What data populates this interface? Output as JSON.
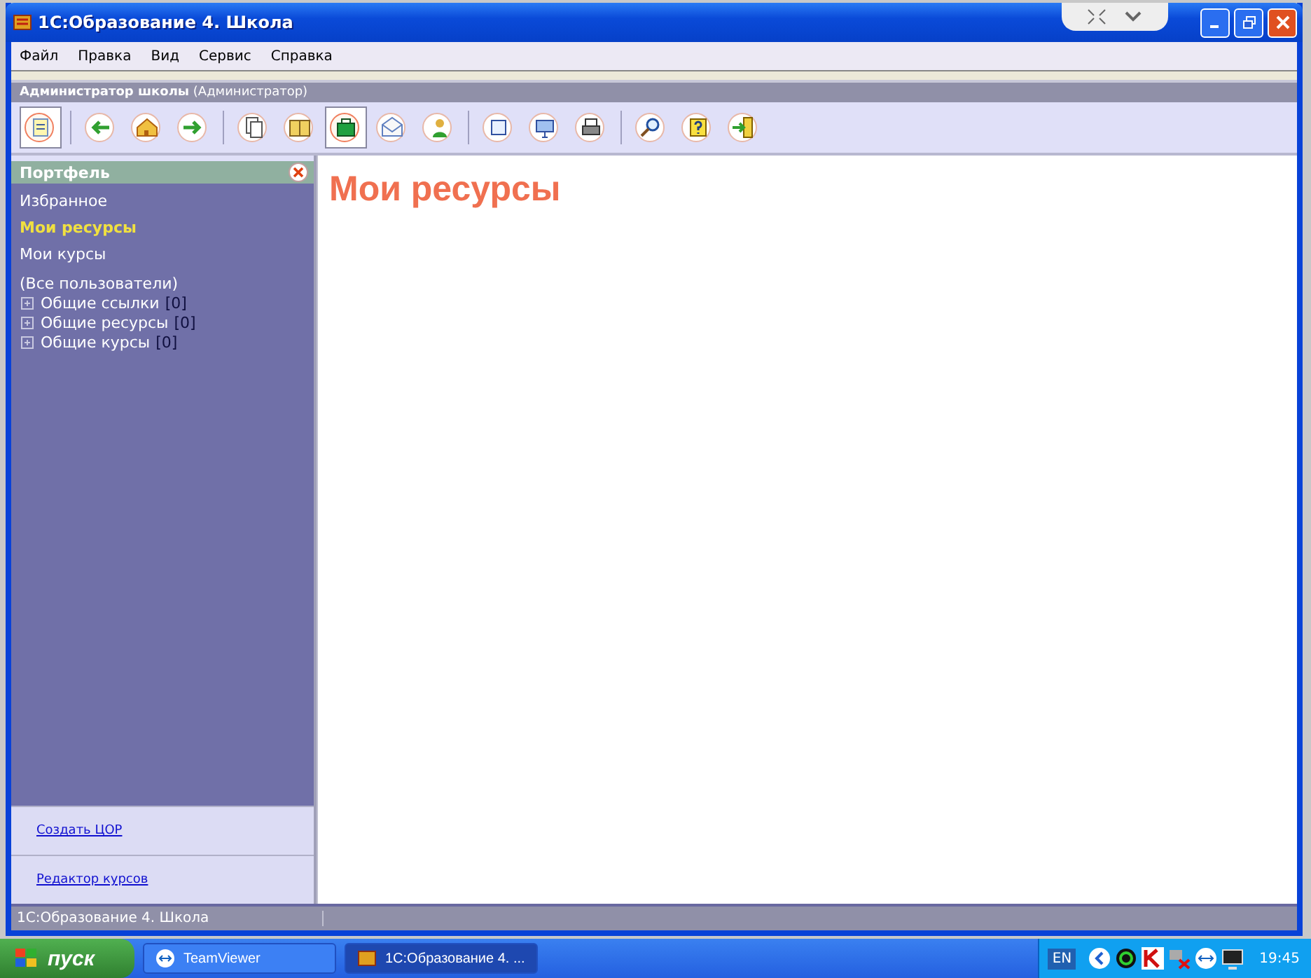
{
  "window": {
    "title": "1С:Образование 4. Школа"
  },
  "menu": [
    "Файл",
    "Правка",
    "Вид",
    "Сервис",
    "Справка"
  ],
  "user_bar": {
    "name": "Администратор школы",
    "role": "(Администратор)"
  },
  "toolbar": [
    {
      "kind": "document",
      "selected": true
    },
    {
      "kind": "separator"
    },
    {
      "kind": "back",
      "selected": false
    },
    {
      "kind": "home",
      "selected": false
    },
    {
      "kind": "forward",
      "selected": false
    },
    {
      "kind": "separator"
    },
    {
      "kind": "pages",
      "selected": false
    },
    {
      "kind": "book",
      "selected": false
    },
    {
      "kind": "briefcase",
      "selected": true
    },
    {
      "kind": "envelope",
      "selected": false
    },
    {
      "kind": "person",
      "selected": false
    },
    {
      "kind": "separator"
    },
    {
      "kind": "frame",
      "selected": false
    },
    {
      "kind": "monitor",
      "selected": false
    },
    {
      "kind": "printer",
      "selected": false
    },
    {
      "kind": "separator"
    },
    {
      "kind": "search",
      "selected": false
    },
    {
      "kind": "help",
      "selected": false
    },
    {
      "kind": "exit",
      "selected": false
    }
  ],
  "sidebar": {
    "title": "Портфель",
    "items": [
      {
        "label": "Избранное",
        "selected": false
      },
      {
        "label": "Мои ресурсы",
        "selected": true
      },
      {
        "label": "Мои курсы",
        "selected": false
      }
    ],
    "group_label": "(Все пользователи)",
    "tree": [
      {
        "label": "Общие ссылки",
        "count": "[0]",
        "expanded": false
      },
      {
        "label": "Общие ресурсы",
        "count": "[0]",
        "expanded": false
      },
      {
        "label": "Общие курсы",
        "count": "[0]",
        "expanded": false
      }
    ],
    "links": [
      "Создать ЦОР",
      "Редактор курсов"
    ]
  },
  "content": {
    "heading": "Мои ресурсы"
  },
  "status_bar": {
    "text": "1С:Образование 4. Школа"
  },
  "taskbar": {
    "start": "пуск",
    "tasks": [
      {
        "label": "TeamViewer",
        "kind": "teamviewer",
        "selected": false
      },
      {
        "label": "1С:Образование 4. ...",
        "kind": "app",
        "selected": true
      }
    ],
    "language": "EN",
    "clock": "19:45"
  }
}
